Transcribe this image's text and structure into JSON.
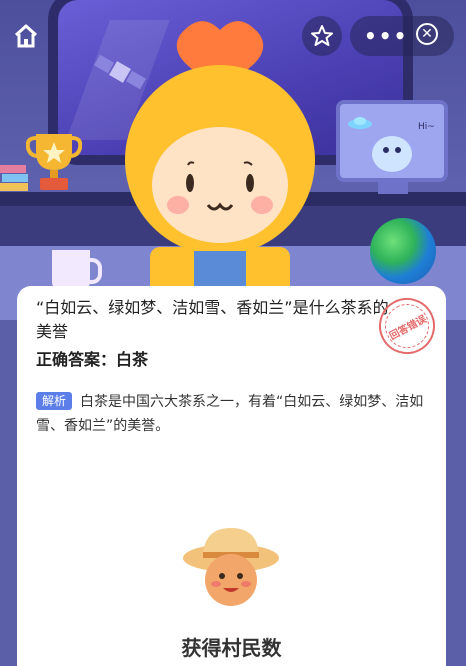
{
  "topbar": {
    "home_icon": "home-icon",
    "favorite_icon": "star-icon",
    "more_label": "•••",
    "close_icon": "close-icon",
    "close_glyph": "✕"
  },
  "scene": {
    "monitor_text": "Hi~"
  },
  "card": {
    "question": "“白如云、绿如梦、洁如雪、香如兰”是什么茶系的美誉",
    "answer_label": "正确答案：",
    "answer_value": "白茶",
    "stamp_text": "回答错误",
    "analysis_badge": "解析",
    "analysis_text": "白茶是中国六大茶系之一，有着“白如云、绿如梦、洁如雪、香如兰”的美誉。",
    "reward_title": "获得村民数"
  },
  "colors": {
    "accent_badge": "#5b7ee8",
    "stamp": "#e46a6a",
    "scene_bg": "#5d61ad"
  }
}
